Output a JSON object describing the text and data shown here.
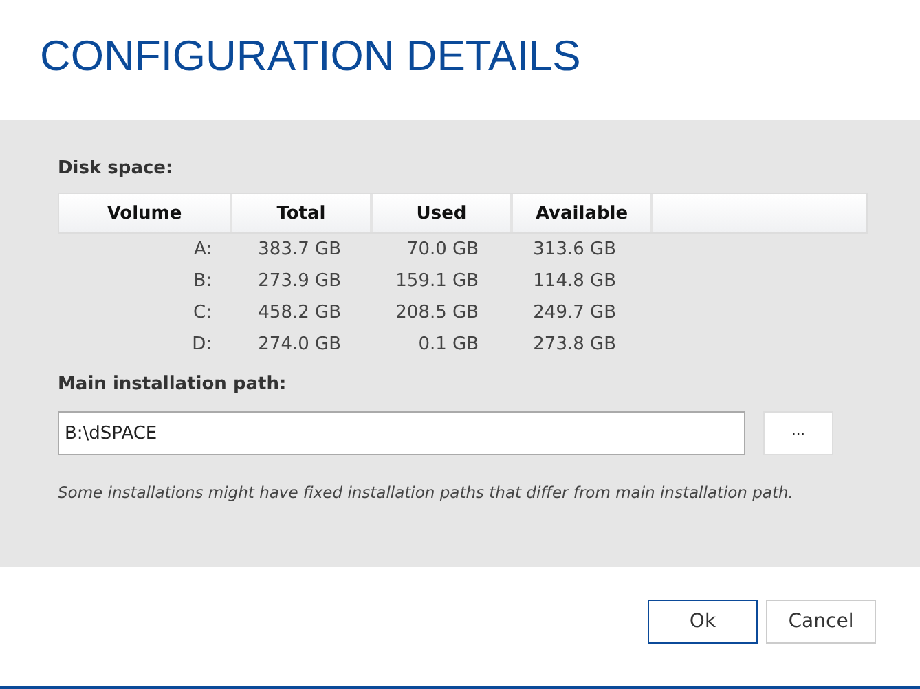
{
  "title": "CONFIGURATION DETAILS",
  "disk_space": {
    "label": "Disk space:",
    "columns": [
      "Volume",
      "Total",
      "Used",
      "Available"
    ],
    "rows": [
      [
        "A:",
        "383.7 GB",
        "70.0 GB",
        "313.6 GB"
      ],
      [
        "B:",
        "273.9 GB",
        "159.1 GB",
        "114.8 GB"
      ],
      [
        "C:",
        "458.2 GB",
        "208.5 GB",
        "249.7 GB"
      ],
      [
        "D:",
        "274.0 GB",
        "0.1 GB",
        "273.8 GB"
      ]
    ]
  },
  "installation_path": {
    "label": "Main installation path:",
    "value": "B:\\dSPACE",
    "browse_button": "...",
    "note": "Some installations might have fixed installation paths that differ from main installation path."
  },
  "buttons": [
    {
      "label": "Ok",
      "default": true
    },
    {
      "label": "Cancel",
      "default": false
    }
  ]
}
